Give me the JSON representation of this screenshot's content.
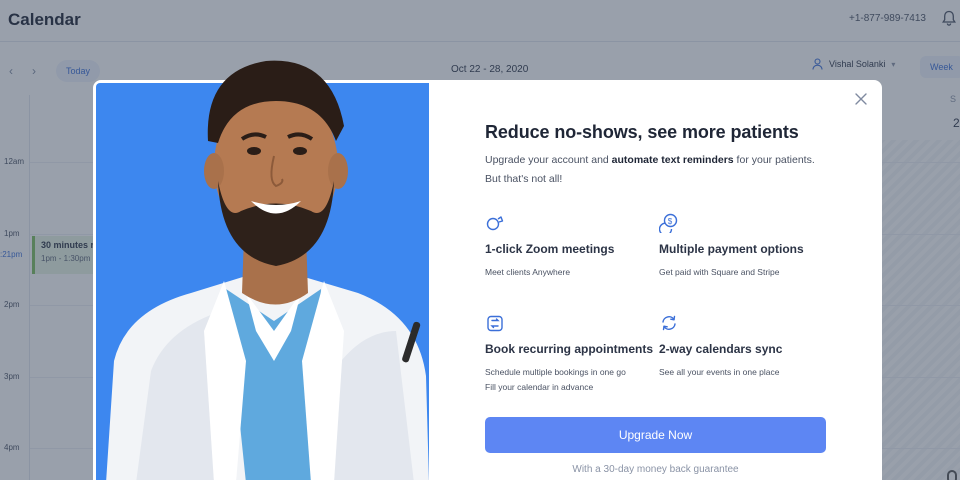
{
  "app": {
    "title": "Calendar",
    "phone": "+1-877-989-7413",
    "icons": {
      "notifications": "bell-icon",
      "prev": "chevron-left-icon",
      "next": "chevron-right-icon",
      "user": "user-icon"
    }
  },
  "toolbar": {
    "today_label": "Today",
    "date_range": "Oct 22 - 28, 2020",
    "user_name": "Vishal Solanki",
    "view_label": "Week",
    "day_head": "S",
    "day_num": "2"
  },
  "time_labels": [
    "12am",
    "1pm",
    "2pm",
    "3pm",
    "4pm"
  ],
  "now_label": ":21pm",
  "event": {
    "title": "30 minutes r",
    "time": "1pm - 1:30pm"
  },
  "modal": {
    "headline": "Reduce no-shows, see more patients",
    "subline_pre": "Upgrade your account and ",
    "subline_bold": "automate text reminders",
    "subline_post": " for your patients.",
    "subline_line2": "But that's not all!",
    "features": [
      {
        "icon": "zoom-icon",
        "title": "1-click Zoom meetings",
        "desc": [
          "Meet clients Anywhere"
        ]
      },
      {
        "icon": "dollar-coins-icon",
        "title": "Multiple payment options",
        "desc": [
          "Get paid with Square and Stripe"
        ]
      },
      {
        "icon": "recurring-icon",
        "title": "Book recurring appointments",
        "desc": [
          "Schedule multiple bookings in one go",
          "Fill your calendar in advance"
        ]
      },
      {
        "icon": "sync-icon",
        "title": "2-way calendars sync",
        "desc": [
          "See all your events in one place"
        ]
      }
    ],
    "cta_label": "Upgrade Now",
    "guarantee": "With a 30-day money back guarantee"
  },
  "colors": {
    "accent": "#5d86f3",
    "hero_bg": "#3d87ef",
    "overlay": "rgba(52,66,88,0.5)",
    "event_bg": "#e9f5e4"
  }
}
